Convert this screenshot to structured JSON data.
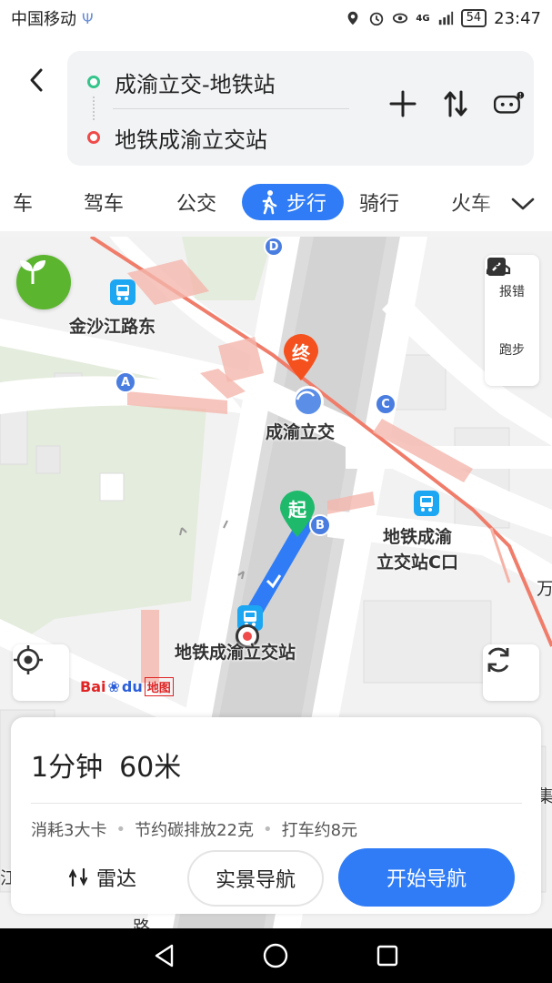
{
  "status_bar": {
    "carrier": "中国移动",
    "network": "4G",
    "battery": "54",
    "time": "23:47"
  },
  "route": {
    "start": "成渝立交-地铁站",
    "end": "地铁成渝立交站"
  },
  "modes": {
    "items": [
      "车",
      "驾车",
      "公交",
      "步行",
      "骑行",
      "火车"
    ],
    "active": "步行"
  },
  "map": {
    "labels": {
      "jinsha": "金沙江路东",
      "chengyu": "成渝立交",
      "station_c": "地铁成渝\n立交站C口",
      "station": "地铁成渝立交站",
      "end_marker": "终",
      "start_marker": "起",
      "exit_a": "A",
      "exit_b": "B",
      "exit_c": "C",
      "exit_d": "D",
      "edge_right_1": "万",
      "edge_right_2": "集",
      "edge_left": "江",
      "edge_bottom": "路"
    },
    "tools": {
      "report": "报错",
      "run": "跑步"
    },
    "logo_text_bai": "Bai",
    "logo_text_du": "du",
    "logo_text_map": "地图"
  },
  "summary": {
    "time": "1分钟",
    "distance": "60米",
    "stats": [
      "消耗3大卡",
      "节约碳排放22克",
      "打车约8元"
    ],
    "radar": "雷达",
    "real_nav": "实景导航",
    "start_nav": "开始导航"
  },
  "colors": {
    "accent": "#2f7cf6",
    "start_green": "#35c48a",
    "end_red": "#ef4b4b",
    "metro_line": "#f07c6a"
  }
}
